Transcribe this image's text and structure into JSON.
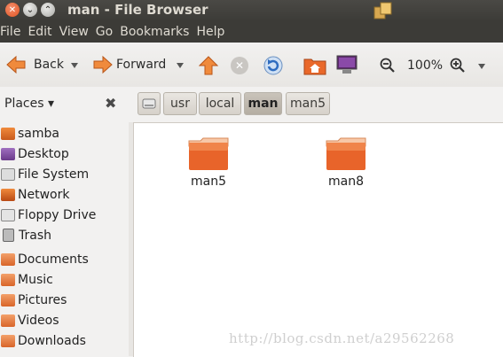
{
  "window": {
    "title": "man - File Browser"
  },
  "menu": [
    "File",
    "Edit",
    "View",
    "Go",
    "Bookmarks",
    "Help"
  ],
  "toolbar": {
    "back_label": "Back",
    "forward_label": "Forward",
    "zoom_level": "100%"
  },
  "places": {
    "header": "Places ▾"
  },
  "path": [
    "usr",
    "local",
    "man",
    "man5"
  ],
  "sidebar": {
    "items": [
      {
        "label": "samba",
        "icon": "network-share-icon"
      },
      {
        "label": "Desktop",
        "icon": "desktop-icon"
      },
      {
        "label": "File System",
        "icon": "harddisk-icon"
      },
      {
        "label": "Network",
        "icon": "network-icon"
      },
      {
        "label": "Floppy Drive",
        "icon": "floppy-icon"
      },
      {
        "label": "Trash",
        "icon": "trash-icon"
      },
      {
        "label": "Documents",
        "icon": "folder-icon"
      },
      {
        "label": "Music",
        "icon": "folder-icon"
      },
      {
        "label": "Pictures",
        "icon": "folder-icon"
      },
      {
        "label": "Videos",
        "icon": "folder-icon"
      },
      {
        "label": "Downloads",
        "icon": "folder-icon"
      }
    ]
  },
  "files": [
    {
      "name": "man5",
      "icon": "folder-icon"
    },
    {
      "name": "man8",
      "icon": "folder-icon"
    }
  ],
  "watermark": "http://blog.csdn.net/a29562268",
  "colors": {
    "accent": "#e25a1c",
    "titlebar": "#3c3b37"
  }
}
